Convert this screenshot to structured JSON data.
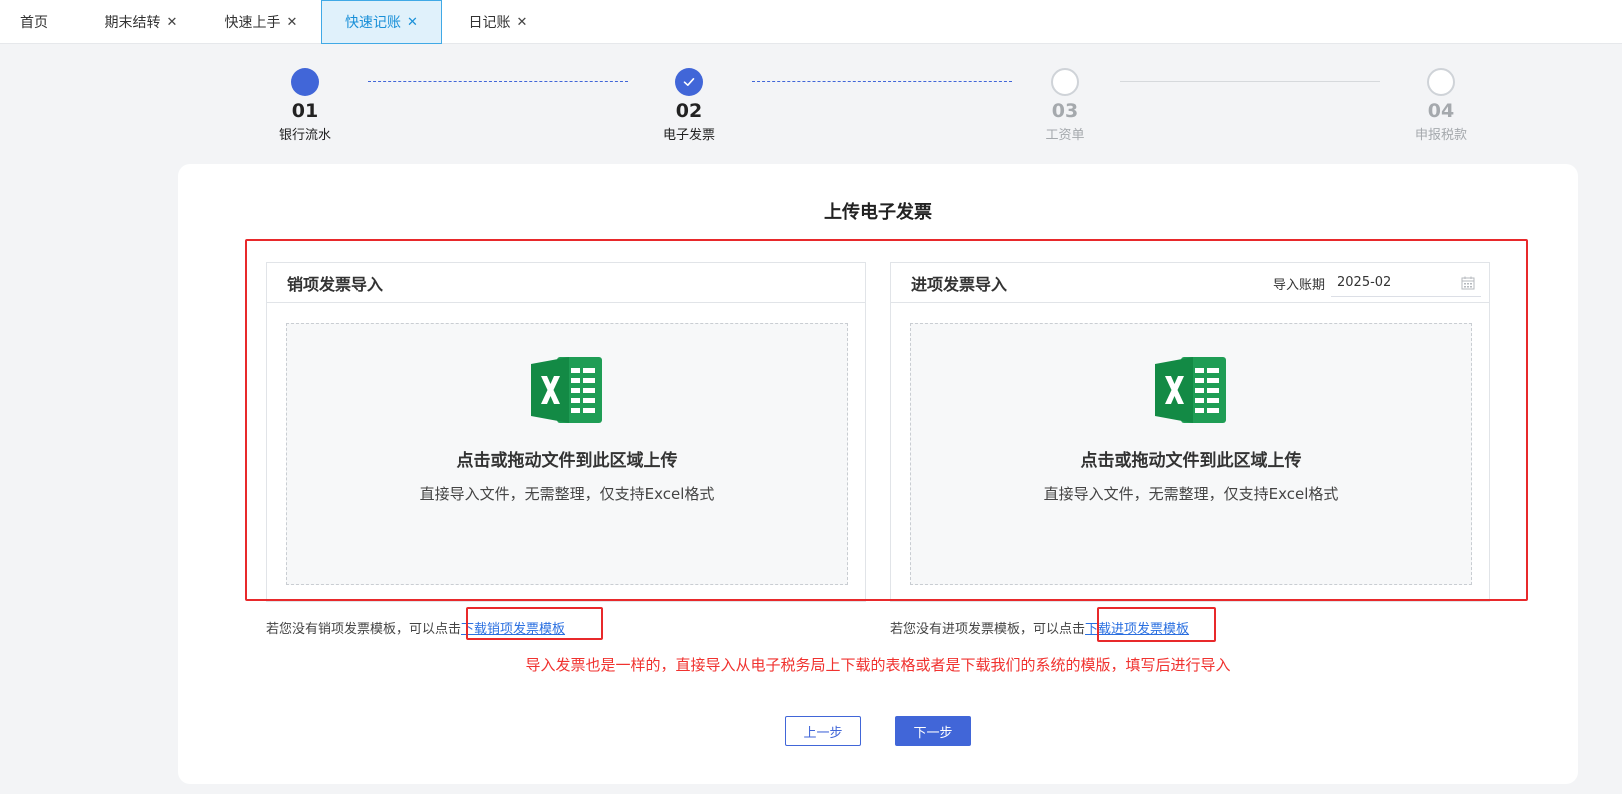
{
  "tabs": [
    {
      "label": "首页",
      "closable": false,
      "active": false
    },
    {
      "label": "期末结转",
      "closable": true,
      "active": false
    },
    {
      "label": "快速上手",
      "closable": true,
      "active": false
    },
    {
      "label": "快速记账",
      "closable": true,
      "active": true
    },
    {
      "label": "日记账",
      "closable": true,
      "active": false
    }
  ],
  "close_glyph": "✕",
  "steps": [
    {
      "num": "01",
      "label": "银行流水",
      "status": "done"
    },
    {
      "num": "02",
      "label": "电子发票",
      "status": "current"
    },
    {
      "num": "03",
      "label": "工资单",
      "status": "pending"
    },
    {
      "num": "04",
      "label": "申报税款",
      "status": "pending"
    }
  ],
  "card": {
    "title": "上传电子发票",
    "sales": {
      "title": "销项发票导入",
      "upload_title": "点击或拖动文件到此区域上传",
      "upload_sub": "直接导入文件，无需整理，仅支持Excel格式",
      "hint_text": "若您没有销项发票模板，可以点击",
      "hint_link": "下载销项发票模板"
    },
    "purchase": {
      "title": "进项发票导入",
      "period_label": "导入账期",
      "period_value": "2025-02",
      "upload_title": "点击或拖动文件到此区域上传",
      "upload_sub": "直接导入文件，无需整理，仅支持Excel格式",
      "hint_text": "若您没有进项发票模板，可以点击",
      "hint_link": "下载进项发票模板"
    },
    "note": "导入发票也是一样的，直接导入从电子税务局上下载的表格或者是下载我们的系统的模版，填写后进行导入",
    "prev_label": "上一步",
    "next_label": "下一步"
  },
  "colors": {
    "primary": "#4166d8",
    "tab_active_bg": "#e0f1fb",
    "tab_active_text": "#1a90d8",
    "annotation": "#e8292b",
    "excel_green": "#1f9d55"
  }
}
